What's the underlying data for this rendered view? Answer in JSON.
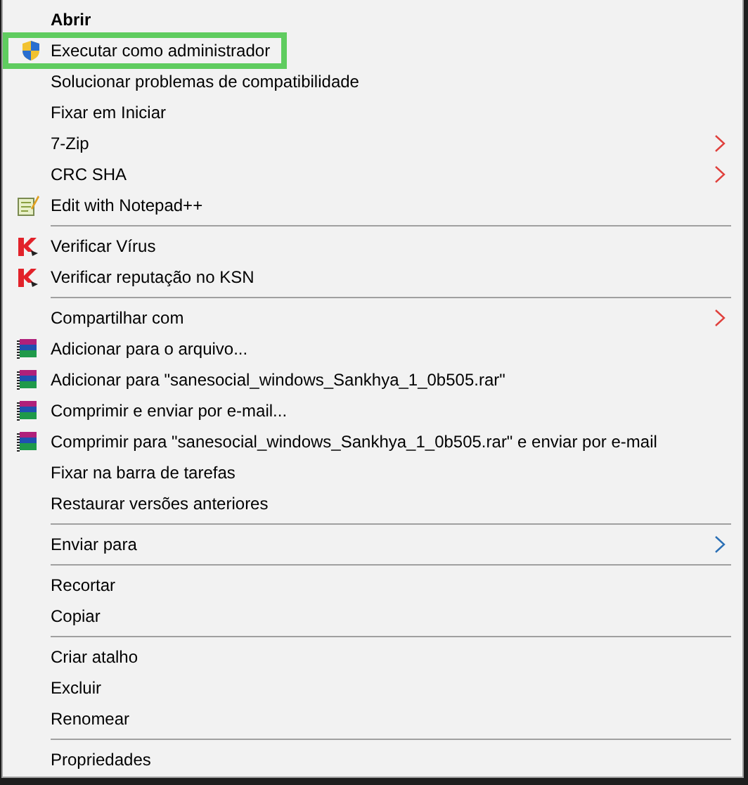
{
  "menu": {
    "items": [
      {
        "kind": "plain",
        "label": "Abrir",
        "bold": true
      },
      {
        "kind": "shield",
        "label": "Executar como administrador",
        "highlighted": true
      },
      {
        "kind": "plain",
        "label": "Solucionar problemas de compatibilidade"
      },
      {
        "kind": "plain",
        "label": "Fixar em Iniciar"
      },
      {
        "kind": "plain",
        "label": "7-Zip",
        "submenu": true,
        "color": "#e0403c"
      },
      {
        "kind": "plain",
        "label": "CRC SHA",
        "submenu": true,
        "color": "#e0403c"
      },
      {
        "kind": "notepad",
        "label": "Edit with Notepad++"
      },
      {
        "kind": "separator"
      },
      {
        "kind": "antivirus",
        "label": "Verificar Vírus"
      },
      {
        "kind": "antivirus",
        "label": "Verificar reputação no KSN"
      },
      {
        "kind": "separator"
      },
      {
        "kind": "plain",
        "label": "Compartilhar com",
        "submenu": true,
        "color": "#e0403c"
      },
      {
        "kind": "archive",
        "label": "Adicionar para o arquivo..."
      },
      {
        "kind": "archive",
        "label": "Adicionar para \"sanesocial_windows_Sankhya_1_0b505.rar\""
      },
      {
        "kind": "archive",
        "label": "Comprimir e enviar por e-mail..."
      },
      {
        "kind": "archive",
        "label": "Comprimir para \"sanesocial_windows_Sankhya_1_0b505.rar\" e enviar por e-mail"
      },
      {
        "kind": "plain",
        "label": "Fixar na barra de tarefas"
      },
      {
        "kind": "plain",
        "label": "Restaurar versões anteriores"
      },
      {
        "kind": "separator"
      },
      {
        "kind": "plain",
        "label": "Enviar para",
        "submenu": true,
        "color": "#2a6fb5"
      },
      {
        "kind": "separator"
      },
      {
        "kind": "plain",
        "label": "Recortar"
      },
      {
        "kind": "plain",
        "label": "Copiar"
      },
      {
        "kind": "separator"
      },
      {
        "kind": "plain",
        "label": "Criar atalho"
      },
      {
        "kind": "plain",
        "label": "Excluir"
      },
      {
        "kind": "plain",
        "label": "Renomear"
      },
      {
        "kind": "separator"
      },
      {
        "kind": "plain",
        "label": "Propriedades"
      }
    ]
  }
}
